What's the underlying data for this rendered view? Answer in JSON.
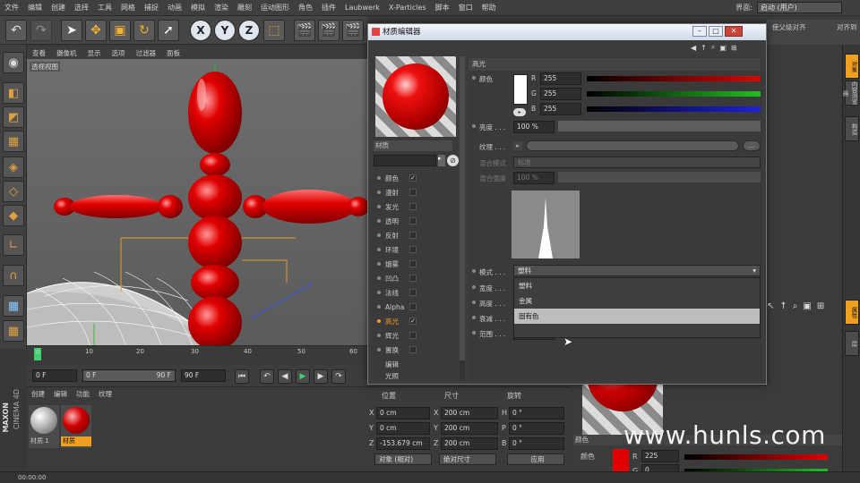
{
  "menubar": {
    "items": [
      "文件",
      "编辑",
      "创建",
      "选择",
      "工具",
      "网格",
      "捕捉",
      "动画",
      "模拟",
      "渲染",
      "雕刻",
      "运动图形",
      "角色",
      "插件",
      "Laubwerk",
      "X-Particles",
      "脚本",
      "窗口",
      "帮助"
    ],
    "layout_label": "界面:",
    "layout_value": "启动 (用户)"
  },
  "toolbar": {
    "axis_x": "X",
    "axis_y": "Y",
    "axis_z": "Z",
    "right_labels": [
      "使父级对齐",
      "对齐到",
      "转到第一激活对象"
    ]
  },
  "viewport": {
    "menu": [
      "查看",
      "摄像机",
      "显示",
      "选项",
      "过滤器",
      "面板"
    ],
    "label": "透视视图"
  },
  "timeline": {
    "ticks": [
      "0",
      "10",
      "20",
      "30",
      "40",
      "50",
      "60"
    ],
    "start_frame": "0 F",
    "current_frame": "0 F",
    "end_frame_inner": "90 F",
    "end_frame": "90 F"
  },
  "material_manager": {
    "menu": [
      "创建",
      "编辑",
      "功能",
      "纹理"
    ],
    "materials": [
      {
        "name": "材质.1",
        "selected": false,
        "color": "#bcbcbc"
      },
      {
        "name": "材质",
        "selected": true,
        "color": "#d00000"
      }
    ],
    "brand_maxon": "MAXON",
    "brand_c4d": "CINEMA 4D"
  },
  "coordinates": {
    "headers": [
      "位置",
      "尺寸",
      "旋转"
    ],
    "rows": [
      {
        "axis": "X",
        "pos": "0 cm",
        "size_axis": "X",
        "size": "200 cm",
        "rot_axis": "H",
        "rot": "0 °"
      },
      {
        "axis": "Y",
        "pos": "0 cm",
        "size_axis": "Y",
        "size": "200 cm",
        "rot_axis": "P",
        "rot": "0 °"
      },
      {
        "axis": "Z",
        "pos": "-153.679 cm",
        "size_axis": "Z",
        "size": "200 cm",
        "rot_axis": "B",
        "rot": "0 °"
      }
    ],
    "mode1": "对象 (相对)",
    "mode2": "绝对尺寸",
    "apply": "应用"
  },
  "status": {
    "time": "00:00:00"
  },
  "attr_panel": {
    "color_label": "颜色",
    "color_section": "颜色",
    "r_label": "R",
    "r_value": "225",
    "g_label": "G",
    "g_value": "0"
  },
  "right_tabs": [
    "对象",
    "内容浏览器",
    "构造",
    "属性",
    "层"
  ],
  "dialog": {
    "title": "材质编辑器",
    "material_name": "材质",
    "channels": [
      {
        "label": "颜色",
        "checked": true,
        "active": false
      },
      {
        "label": "漫射",
        "checked": false,
        "active": false
      },
      {
        "label": "发光",
        "checked": false,
        "active": false
      },
      {
        "label": "透明",
        "checked": false,
        "active": false
      },
      {
        "label": "反射",
        "checked": false,
        "active": false
      },
      {
        "label": "环境",
        "checked": false,
        "active": false
      },
      {
        "label": "烟雾",
        "checked": false,
        "active": false
      },
      {
        "label": "凹凸",
        "checked": false,
        "active": false
      },
      {
        "label": "法线",
        "checked": false,
        "active": false
      },
      {
        "label": "Alpha",
        "checked": false,
        "active": false
      },
      {
        "label": "高光",
        "checked": true,
        "active": true
      },
      {
        "label": "辉光",
        "checked": false,
        "active": false
      },
      {
        "label": "置换",
        "checked": false,
        "active": false
      },
      {
        "label": "编辑",
        "checked": null,
        "active": false
      },
      {
        "label": "光照",
        "checked": null,
        "active": false
      }
    ],
    "section_title": "高光",
    "color_label": "颜色",
    "r_label": "R",
    "r_value": "255",
    "g_label": "G",
    "g_value": "255",
    "b_label": "B",
    "b_value": "255",
    "brightness_label": "亮度 . . .",
    "brightness_value": "100 %",
    "texture_label": "纹理 . . .",
    "texture_btn": "...",
    "blend_mode_label": "混合模式",
    "blend_mode_value": "标准",
    "blend_strength_label": "混合强度",
    "blend_strength_value": "100 %",
    "mode_label": "模式 . . .",
    "mode_value": "塑料",
    "width_label": "宽度 . . .",
    "height_label": "高度 . . .",
    "falloff_label": "衰减 . . .",
    "range_label": "范围 . . .",
    "range_value": "0 %",
    "popup_options": [
      "塑料",
      "金属",
      "固有色"
    ],
    "popup_highlight_index": 2
  },
  "watermark": "www.hunls.com",
  "colors": {
    "accent_red": "#d00000",
    "highlight_orange": "#f0a020",
    "r_slider": "#c02020",
    "g_slider": "#20a020",
    "b_slider": "#2020c0"
  }
}
